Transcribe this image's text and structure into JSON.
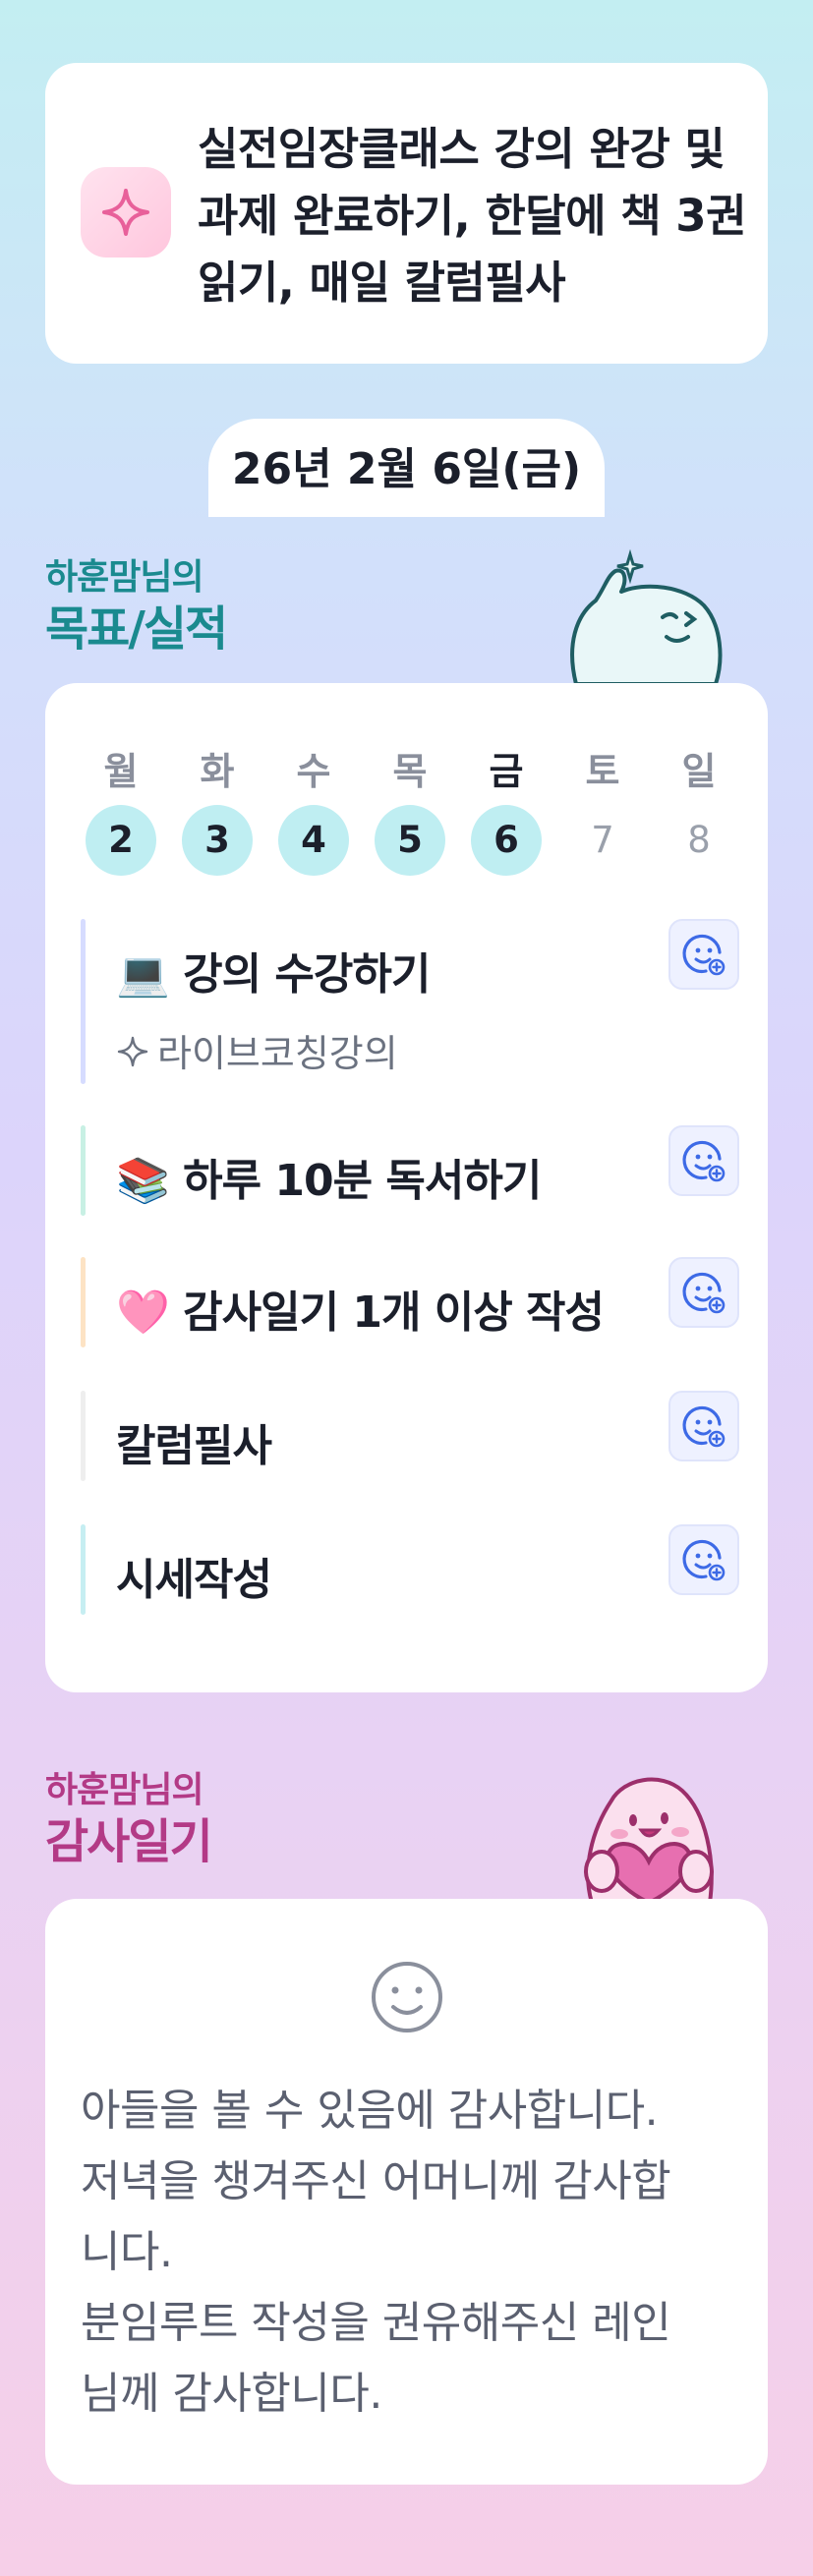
{
  "goal": {
    "icon": "sparkle-icon",
    "text": "실전임장클래스 강의 완강 및 과제 완료하기, 한달에 책 3권 읽기, 매일 칼럼필사"
  },
  "date_label": "26년 2월 6일(금)",
  "goals_section": {
    "subtitle": "하훈맘님의",
    "title": "목표/실적"
  },
  "week": [
    {
      "day": "월",
      "num": "2",
      "state": "done"
    },
    {
      "day": "화",
      "num": "3",
      "state": "done"
    },
    {
      "day": "수",
      "num": "4",
      "state": "done"
    },
    {
      "day": "목",
      "num": "5",
      "state": "done"
    },
    {
      "day": "금",
      "num": "6",
      "state": "today"
    },
    {
      "day": "토",
      "num": "7",
      "state": "none"
    },
    {
      "day": "일",
      "num": "8",
      "state": "none"
    }
  ],
  "tasks": [
    {
      "emoji": "💻",
      "title": "강의 수강하기",
      "sub": "라이브코칭강의",
      "bar_color": "#d6dcff"
    },
    {
      "emoji": "📚",
      "title": "하루 10분 독서하기",
      "bar_color": "#c8f0e4"
    },
    {
      "emoji": "🩷",
      "title": "감사일기 1개 이상 작성",
      "bar_color": "#fde3c4"
    },
    {
      "emoji": "",
      "title": "칼럼필사",
      "bar_color": "#eeeeee"
    },
    {
      "emoji": "",
      "title": "시세작성",
      "bar_color": "#c6eef2"
    }
  ],
  "reaction_icon": "add-reaction-icon",
  "gratitude_section": {
    "subtitle": "하훈맘님의",
    "title": "감사일기"
  },
  "gratitude": {
    "icon": "smile-icon",
    "lines": [
      "아들을 볼 수 있음에 감사합니다.",
      "저녁을 챙겨주신 어머니께 감사합",
      "니다.",
      "분임루트 작성을 권유해주신 레인",
      "님께 감사합니다."
    ]
  },
  "colors": {
    "goal_heading": "#1a8a8f",
    "gratitude_heading": "#b33a86",
    "day_done": "#bfeef2",
    "reaction_blue": "#3d6ae6"
  }
}
